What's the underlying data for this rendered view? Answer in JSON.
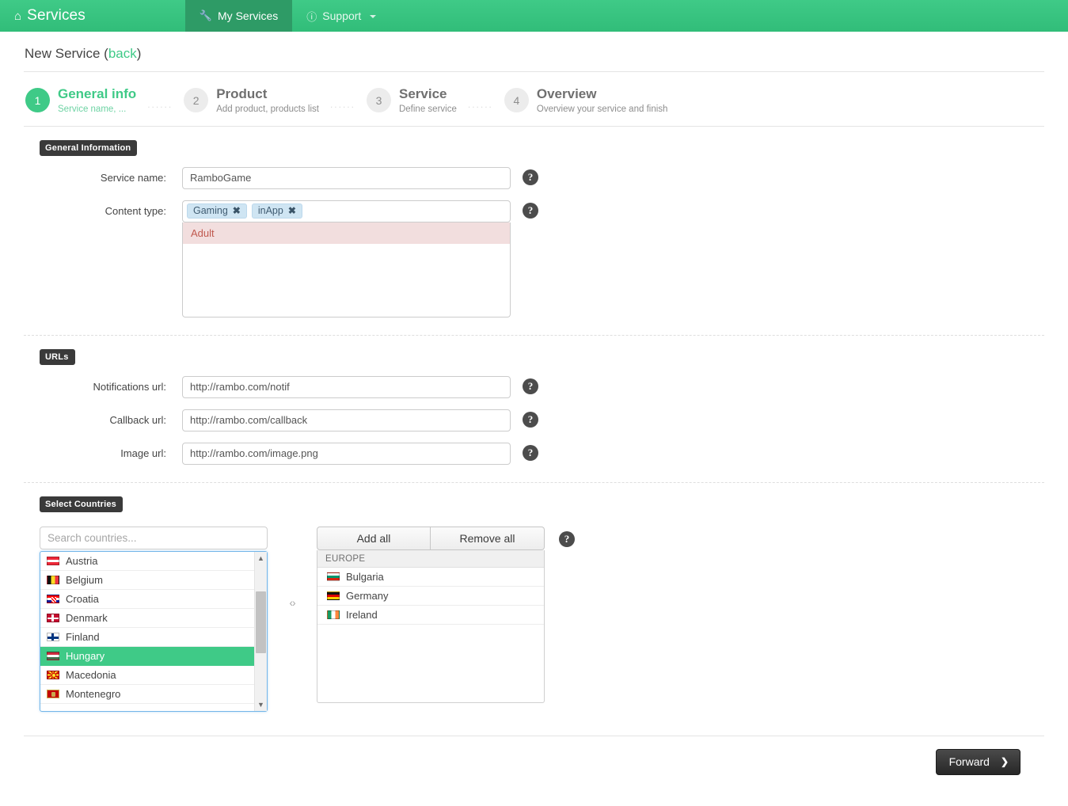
{
  "navbar": {
    "brand": "Services",
    "brand_icon": "home-icon",
    "items": [
      {
        "label": "My Services",
        "icon": "wrench-icon",
        "active": true,
        "caret": false
      },
      {
        "label": "Support",
        "icon": "info-circle-icon",
        "active": false,
        "caret": true
      }
    ]
  },
  "page": {
    "title": "New Service",
    "back_label": "back",
    "open_paren": "(",
    "close_paren": ")"
  },
  "steps": [
    {
      "num": "1",
      "name": "General info",
      "desc": "Service name, ...",
      "active": true
    },
    {
      "num": "2",
      "name": "Product",
      "desc": "Add product, products list",
      "active": false
    },
    {
      "num": "3",
      "name": "Service",
      "desc": "Define service",
      "active": false
    },
    {
      "num": "4",
      "name": "Overview",
      "desc": "Overview your service and finish",
      "active": false
    }
  ],
  "step_separator": "......",
  "general_information": {
    "badge": "General Information",
    "service_name": {
      "label": "Service name:",
      "value": "RamboGame",
      "placeholder": ""
    },
    "content_type": {
      "label": "Content type:",
      "tokens": [
        {
          "label": "Gaming",
          "remove": "✖"
        },
        {
          "label": "inApp",
          "remove": "✖"
        }
      ],
      "options": [
        {
          "label": "Adult",
          "highlighted": true
        }
      ]
    }
  },
  "urls": {
    "badge": "URLs",
    "fields": [
      {
        "label": "Notifications url:",
        "value": "http://rambo.com/notif"
      },
      {
        "label": "Callback url:",
        "value": "http://rambo.com/callback"
      },
      {
        "label": "Image url:",
        "value": "http://rambo.com/image.png"
      }
    ]
  },
  "countries": {
    "badge": "Select Countries",
    "search_placeholder": "Search countries...",
    "search_value": "",
    "available": [
      {
        "name": "Austria",
        "flag": "f-at",
        "selected": false
      },
      {
        "name": "Belgium",
        "flag": "f-be",
        "selected": false
      },
      {
        "name": "Croatia",
        "flag": "f-hr",
        "selected": false
      },
      {
        "name": "Denmark",
        "flag": "f-dk",
        "selected": false
      },
      {
        "name": "Finland",
        "flag": "f-fi",
        "selected": false
      },
      {
        "name": "Hungary",
        "flag": "f-hu",
        "selected": true
      },
      {
        "name": "Macedonia",
        "flag": "f-mk",
        "selected": false
      },
      {
        "name": "Montenegro",
        "flag": "f-me",
        "selected": false
      }
    ],
    "transfer_icon": "‹›",
    "add_all_label": "Add all",
    "remove_all_label": "Remove all",
    "selected_group": "EUROPE",
    "selected": [
      {
        "name": "Bulgaria",
        "flag": "f-bg"
      },
      {
        "name": "Germany",
        "flag": "f-de"
      },
      {
        "name": "Ireland",
        "flag": "f-ie"
      }
    ]
  },
  "help_icon": "?",
  "footer": {
    "forward_label": "Forward",
    "forward_chevron": "❯"
  },
  "colors": {
    "brand_green": "#3fca87",
    "navbar_active": "#2e9b66",
    "token_blue": "#cfe5f3",
    "option_red_bg": "#f2dede",
    "option_red_text": "#c0594f",
    "badge_dark": "#3a3a3a",
    "forward_dark": "#272727"
  }
}
